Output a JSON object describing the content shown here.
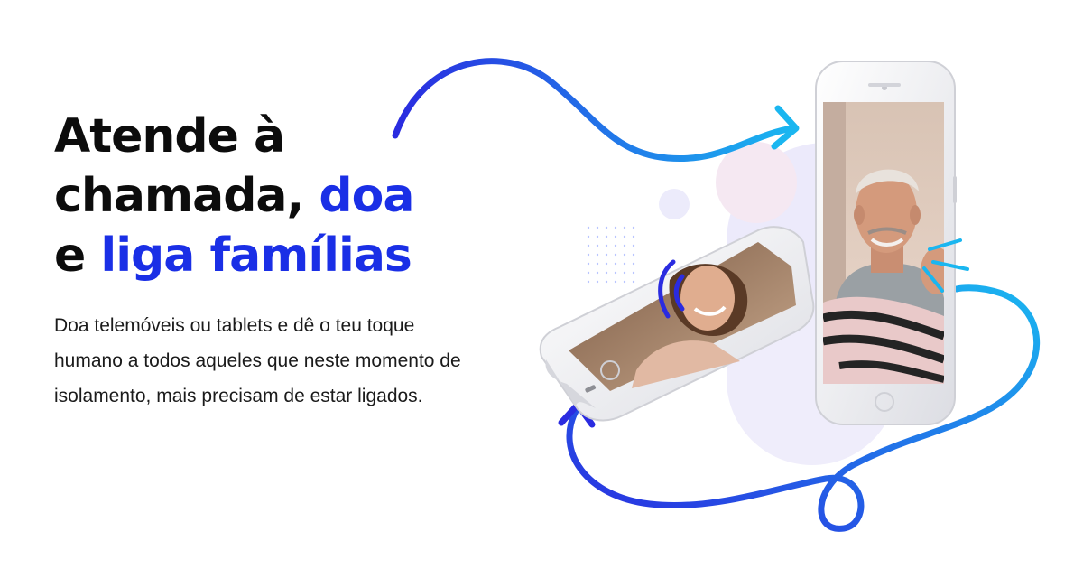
{
  "headline": {
    "line1": "Atende à",
    "line2_plain": "chamada,",
    "line2_highlight": "doa",
    "line3_plain": "e",
    "line3_highlight": "liga famílias"
  },
  "body": "Doa telemóveis ou tablets e dê o teu toque humano a todos aqueles que neste momento de isolamento, mais precisam de estar ligados.",
  "colors": {
    "accent": "#1a2fe6",
    "gradient_start": "#2a2be0",
    "gradient_end": "#1ab6f0",
    "text": "#0c0c0c"
  },
  "illustration": {
    "left_phone_photo": "smiling-young-woman-photo",
    "right_phone_photo": "smiling-older-man-photo"
  }
}
